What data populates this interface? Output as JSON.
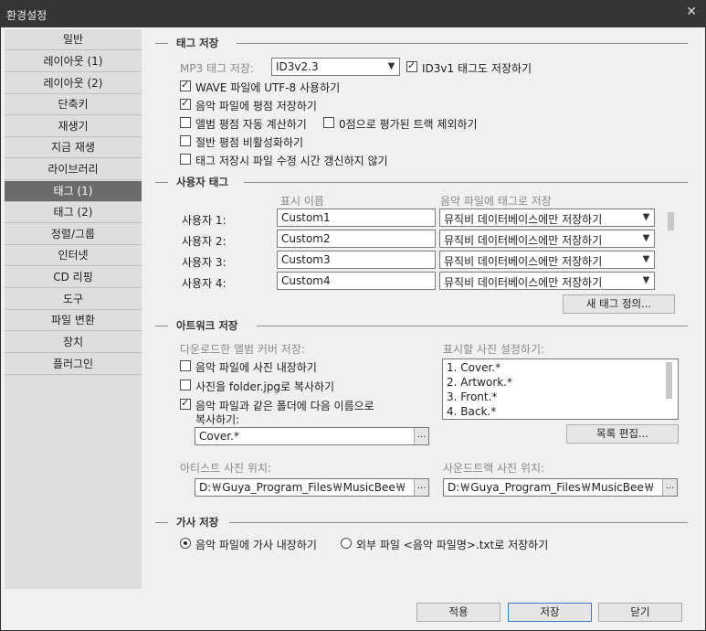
{
  "window": {
    "title": "환경설정",
    "close_glyph": "✕"
  },
  "sidebar": {
    "items": [
      "일반",
      "레이아웃 (1)",
      "레이아웃 (2)",
      "단축키",
      "재생기",
      "지금 재생",
      "라이브러리",
      "태그 (1)",
      "태그 (2)",
      "정렬/그룹",
      "인터넷",
      "CD 리핑",
      "도구",
      "파일 변환",
      "장치",
      "플러그인"
    ],
    "selected": "태그 (1)"
  },
  "tag_save": {
    "title": "태그 저장",
    "mp3_label": "MP3 태그 저장:",
    "mp3_value": "ID3v2.3",
    "id3v1_label": "ID3v1 태그도 저장하기",
    "wave_utf8": "WAVE 파일에 UTF-8 사용하기",
    "save_rating": "음악 파일에 평점 저장하기",
    "album_rating_auto": "앨범 평점 자동 계산하기",
    "exclude_zero": "0점으로 평가된 트랙 제외하기",
    "disable_half": "절반 평점 비활성화하기",
    "no_mtime": "태그 저장시 파일 수정 시간 갱신하지 않기"
  },
  "custom_tags": {
    "title": "사용자 태그",
    "col_display": "표시 이름",
    "col_save": "음악 파일에 태그로 저장",
    "rows": [
      {
        "label": "사용자 1:",
        "name": "Custom1",
        "save": "뮤직비 데이터베이스에만 저장하기"
      },
      {
        "label": "사용자 2:",
        "name": "Custom2",
        "save": "뮤직비 데이터베이스에만 저장하기"
      },
      {
        "label": "사용자 3:",
        "name": "Custom3",
        "save": "뮤직비 데이터베이스에만 저장하기"
      },
      {
        "label": "사용자 4:",
        "name": "Custom4",
        "save": "뮤직비 데이터베이스에만 저장하기"
      }
    ],
    "new_tag_button": "새 태그 정의..."
  },
  "artwork": {
    "title": "아트워크 저장",
    "download_label": "다운로드한 앨범 커버 저장:",
    "embed": "음악 파일에 사진 내장하기",
    "copy_folder_jpg": "사진을 folder.jpg로 복사하기",
    "copy_same_folder_1": "음악 파일과 같은 폴더에 다음 이름으로",
    "copy_same_folder_2": "복사하기:",
    "copy_name": "Cover.*",
    "display_label": "표시할 사진 설정하기:",
    "display_list": [
      "1. Cover.*",
      "2. Artwork.*",
      "3. Front.*",
      "4. Back.*"
    ],
    "edit_list_button": "목록 편집...",
    "artist_label": "아티스트 사진 위치:",
    "artist_path": "D:￦Guya_Program_Files￦MusicBee￦",
    "soundtrack_label": "사운드트랙 사진 위치:",
    "soundtrack_path": "D:￦Guya_Program_Files￦MusicBee￦",
    "ellipsis": "..."
  },
  "lyrics": {
    "title": "가사 저장",
    "embed": "음악 파일에 가사 내장하기",
    "external": "외부 파일 <음악 파일명>.txt로 저장하기"
  },
  "footer": {
    "apply": "적용",
    "save": "저장",
    "close": "닫기"
  },
  "icons": {
    "check": "check-icon",
    "dropdown": "chevron-down-icon",
    "close": "close-icon"
  }
}
